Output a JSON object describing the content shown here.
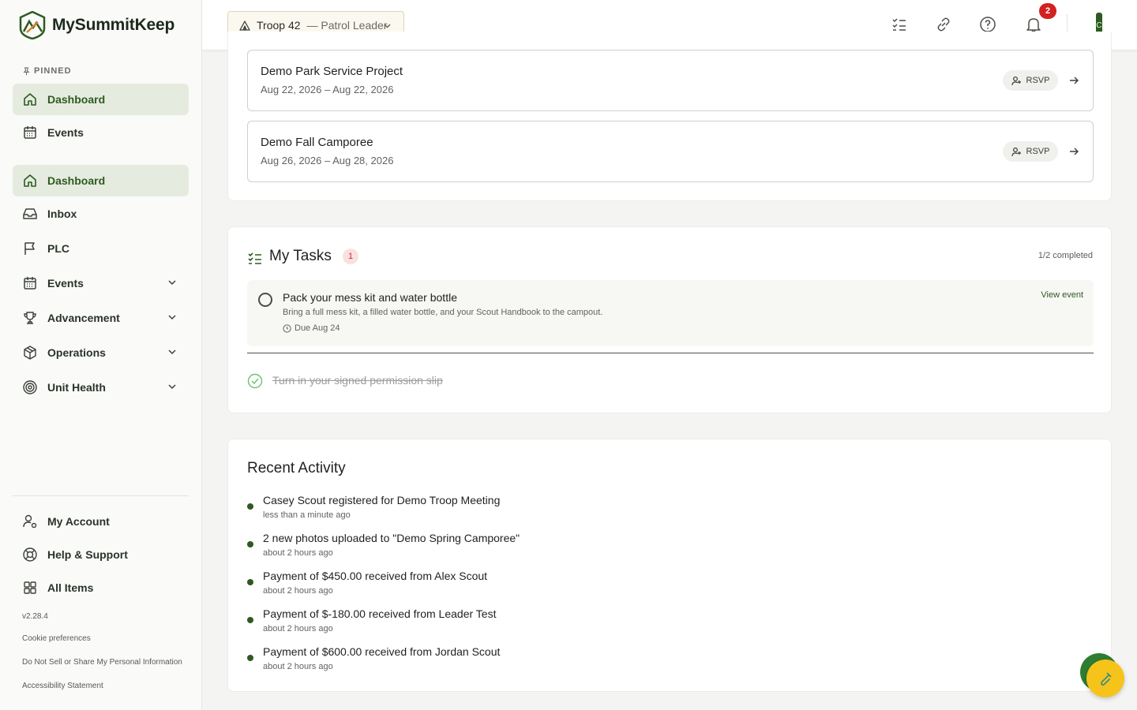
{
  "brand": {
    "name": "MySummitKeep"
  },
  "sidebar": {
    "pinned_label": "PINNED",
    "pinned": [
      {
        "label": "Dashboard",
        "icon": "home-icon",
        "active": true
      },
      {
        "label": "Events",
        "icon": "calendar-icon",
        "active": false
      }
    ],
    "items": [
      {
        "label": "Dashboard",
        "icon": "home-icon",
        "active": true,
        "expandable": false
      },
      {
        "label": "Inbox",
        "icon": "inbox-icon",
        "active": false,
        "expandable": false
      },
      {
        "label": "PLC",
        "icon": "flag-icon",
        "active": false,
        "expandable": false
      },
      {
        "label": "Events",
        "icon": "calendar-icon",
        "active": false,
        "expandable": true
      },
      {
        "label": "Advancement",
        "icon": "trophy-icon",
        "active": false,
        "expandable": true
      },
      {
        "label": "Operations",
        "icon": "box-icon",
        "active": false,
        "expandable": true
      },
      {
        "label": "Unit Health",
        "icon": "target-icon",
        "active": false,
        "expandable": true
      }
    ],
    "bottom": [
      {
        "label": "My Account",
        "icon": "user-gear-icon"
      },
      {
        "label": "Help & Support",
        "icon": "lifebuoy-icon"
      },
      {
        "label": "All Items",
        "icon": "grid-icon"
      }
    ],
    "version": "v2.28.4",
    "footer_links": [
      "Cookie preferences",
      "Do Not Sell or Share My Personal Information",
      "Accessibility Statement"
    ]
  },
  "header": {
    "troop": "Troop 42",
    "role": "— Patrol Leader",
    "notification_count": "2",
    "avatar_initial": "C"
  },
  "events": [
    {
      "title": "Demo Park Service Project",
      "dates": "Aug 22, 2026 – Aug 22, 2026",
      "rsvp_label": "RSVP"
    },
    {
      "title": "Demo Fall Camporee",
      "dates": "Aug 26, 2026 – Aug 28, 2026",
      "rsvp_label": "RSVP"
    }
  ],
  "tasks": {
    "title": "My Tasks",
    "count": "1",
    "progress": "1/2 completed",
    "open": {
      "name": "Pack your mess kit and water bottle",
      "description": "Bring a full mess kit, a filled water bottle, and your Scout Handbook to the campout.",
      "due": "Due Aug 24",
      "link": "View event"
    },
    "done": {
      "name": "Turn in your signed permission slip"
    }
  },
  "activity": {
    "title": "Recent Activity",
    "items": [
      {
        "text": "Casey Scout registered for Demo Troop Meeting",
        "time": "less than a minute ago"
      },
      {
        "text": "2 new photos uploaded to \"Demo Spring Camporee\"",
        "time": "about 2 hours ago"
      },
      {
        "text": "Payment of $450.00 received from Alex Scout",
        "time": "about 2 hours ago"
      },
      {
        "text": "Payment of $-180.00 received from Leader Test",
        "time": "about 2 hours ago"
      },
      {
        "text": "Payment of $600.00 received from Jordan Scout",
        "time": "about 2 hours ago"
      }
    ]
  },
  "colors": {
    "accent": "#2e5a22",
    "active_bg": "#e5ecdf",
    "badge": "#d32020",
    "fab": "#f6c31a"
  }
}
